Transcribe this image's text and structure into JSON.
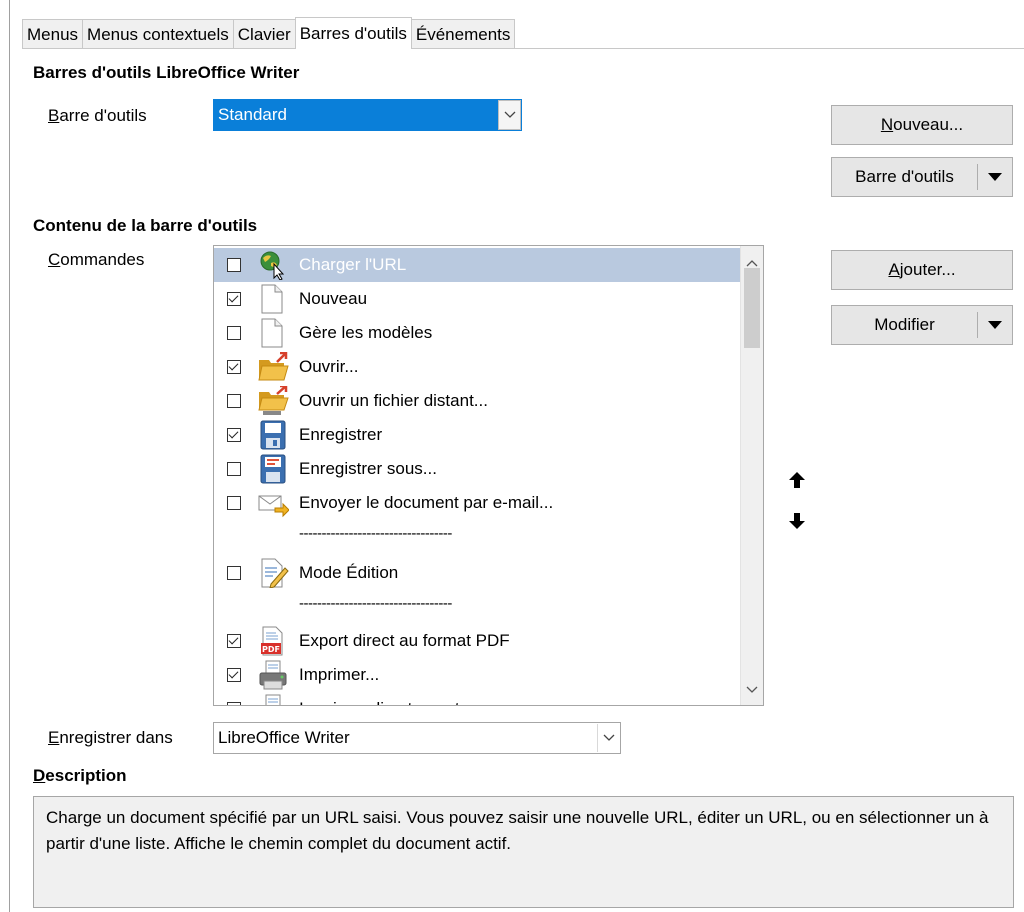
{
  "tabs": [
    {
      "label": "Menus",
      "active": false
    },
    {
      "label": "Menus contextuels",
      "active": false
    },
    {
      "label": "Clavier",
      "active": false
    },
    {
      "label": "Barres d'outils",
      "active": true
    },
    {
      "label": "Événements",
      "active": false
    }
  ],
  "toolbars_section": {
    "title": "Barres d'outils LibreOffice Writer",
    "toolbar_label_mnemonic": "B",
    "toolbar_label_rest": "arre d'outils",
    "toolbar_value": "Standard"
  },
  "buttons": {
    "new_mnemonic": "N",
    "new_rest": "ouveau...",
    "toolbar_menu": "Barre d'outils",
    "add_mnemonic": "A",
    "add_rest": "jouter...",
    "modify": "Modifier"
  },
  "content_section": {
    "title": "Contenu de la barre d'outils",
    "commands_label_mnemonic": "C",
    "commands_label_rest": "ommandes"
  },
  "commands": [
    {
      "label": "Charger l'URL",
      "checked": false,
      "icon": "globe-url-icon",
      "selected": true
    },
    {
      "label": "Nouveau",
      "checked": true,
      "icon": "new-document-icon"
    },
    {
      "label": "Gère les modèles",
      "checked": false,
      "icon": "templates-icon"
    },
    {
      "label": "Ouvrir...",
      "checked": true,
      "icon": "open-folder-icon"
    },
    {
      "label": "Ouvrir un fichier distant...",
      "checked": false,
      "icon": "open-remote-icon"
    },
    {
      "label": "Enregistrer",
      "checked": true,
      "icon": "save-icon"
    },
    {
      "label": "Enregistrer sous...",
      "checked": false,
      "icon": "save-as-icon"
    },
    {
      "label": "Envoyer le document par e-mail...",
      "checked": false,
      "icon": "email-icon"
    },
    {
      "separator": "----------------------------------"
    },
    {
      "label": "Mode Édition",
      "checked": false,
      "icon": "edit-mode-icon"
    },
    {
      "separator": "----------------------------------"
    },
    {
      "label": "Export direct au format PDF",
      "checked": true,
      "icon": "pdf-icon"
    },
    {
      "label": "Imprimer...",
      "checked": true,
      "icon": "print-icon"
    },
    {
      "label": "Imprimer directement",
      "checked": false,
      "icon": "print-direct-icon"
    }
  ],
  "save_in": {
    "label_mnemonic": "E",
    "label_rest": "nregistrer dans",
    "value": "LibreOffice Writer"
  },
  "description": {
    "title_mnemonic": "D",
    "title_rest": "escription",
    "text": "Charge un document spécifié par un URL saisi. Vous pouvez saisir une nouvelle URL, éditer un URL, ou en sélectionner un à partir d'une liste. Affiche le chemin complet du document actif."
  },
  "colors": {
    "selection": "#0a7fd9",
    "row_selected": "#b9c9df"
  }
}
